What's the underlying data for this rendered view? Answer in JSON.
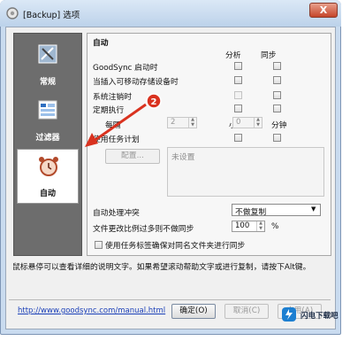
{
  "window": {
    "title": "[Backup] 选项",
    "close_glyph": "X"
  },
  "sidebar": {
    "items": [
      {
        "label": "常规",
        "icon": "settings-icon",
        "active": false
      },
      {
        "label": "过滤器",
        "icon": "filter-icon",
        "active": false
      },
      {
        "label": "自动",
        "icon": "alarm-clock-icon",
        "active": true
      }
    ]
  },
  "panel": {
    "section_title": "自动",
    "col_analyze": "分析",
    "col_sync": "同步",
    "rows": [
      {
        "label": "GoodSync 启动时"
      },
      {
        "label": "当插入可移动存储设备时"
      },
      {
        "label": "系统注销时"
      },
      {
        "label": "定期执行"
      }
    ],
    "every_label": "每隔",
    "hours_value": "2",
    "hours_unit": "小时",
    "minutes_value": "0",
    "minutes_unit": "分钟",
    "task_schedule_label": "使用任务计划",
    "config_button": "配置...",
    "schedule_text": "未设置",
    "auto_conflict_label": "自动处理冲突",
    "auto_conflict_value": "不做复制",
    "file_change_label": "文件更改比例过多则不做同步",
    "file_change_value": "100",
    "file_change_unit": "%",
    "tab_name_label": "使用任务标签确保对同名文件夹进行同步"
  },
  "annotation": {
    "number": "2",
    "color": "#d9321f"
  },
  "footer": {
    "help_text": "鼠标悬停可以查看详细的说明文字。如果希望滚动帮助文字或进行复制，请按下Alt键。",
    "url": "http://www.goodsync.com/manual.html",
    "ok_button": "确定(O)",
    "cancel_button": "取消(C)",
    "apply_button": "应用(A)"
  },
  "watermark": {
    "text": "闪电下载吧"
  }
}
